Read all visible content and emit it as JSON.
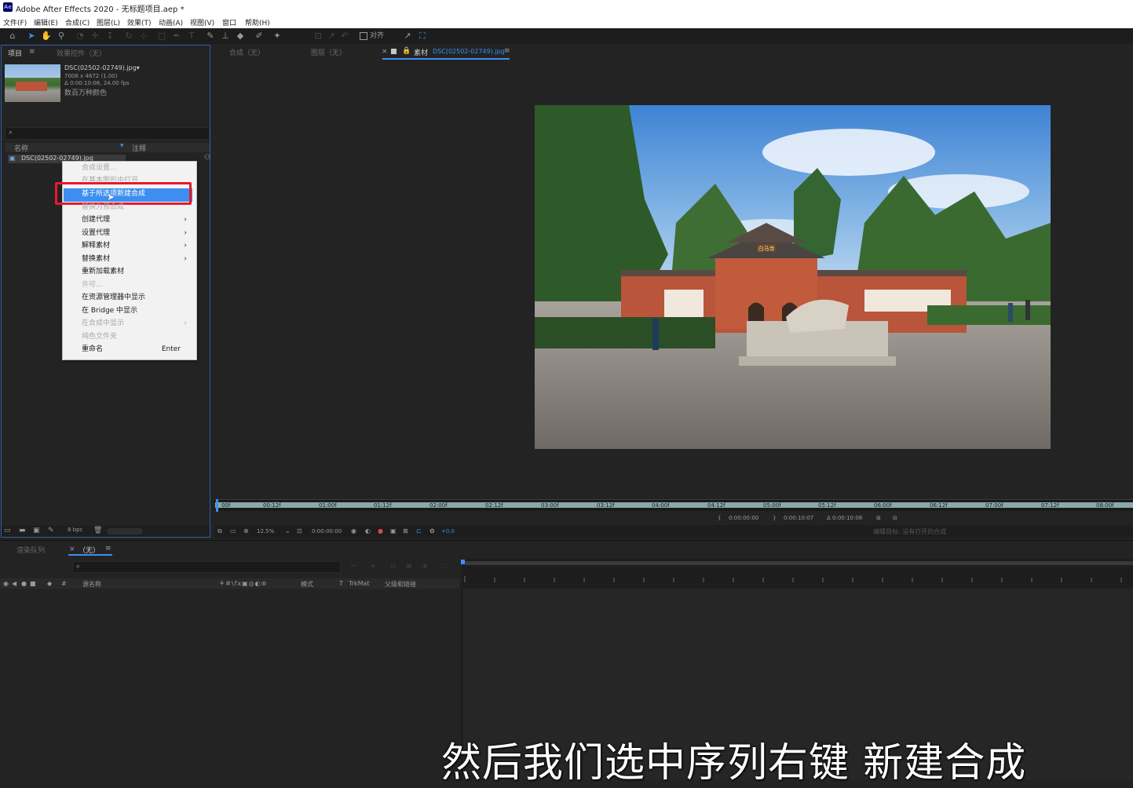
{
  "window": {
    "app_badge": "Ae",
    "title": "Adobe After Effects 2020 - 无标题项目.aep *"
  },
  "menu": [
    "文件(F)",
    "编辑(E)",
    "合成(C)",
    "图层(L)",
    "效果(T)",
    "动画(A)",
    "视图(V)",
    "窗口",
    "帮助(H)"
  ],
  "toolbar": {
    "align_label": "对齐"
  },
  "project_panel": {
    "tab_project": "项目",
    "tab_effects": "效果控件（无）",
    "file_name": "DSC(02502-02749).jpg▾",
    "file_dims": "7008 x 4672 (1.00)",
    "file_duration": "Δ 0:00:10:08, 24.00 fps",
    "file_colors": "数百万种颜色",
    "search_icon": "⌕",
    "col_name": "名称",
    "col_comment": "注释",
    "list_item": "DSC(02502-02749).jpg",
    "bpc": "8 bpc"
  },
  "context_menu": {
    "items": [
      {
        "label": "合成设置...",
        "disabled": true
      },
      {
        "label": "在基本图形中打开",
        "disabled": true
      },
      {
        "label": "基于所选项新建合成",
        "disabled": false,
        "highlighted": true
      },
      {
        "label": "替换为预合成",
        "disabled": true
      },
      {
        "label": "创建代理",
        "disabled": false,
        "submenu": true
      },
      {
        "label": "设置代理",
        "disabled": false,
        "submenu": true
      },
      {
        "label": "解释素材",
        "disabled": false,
        "submenu": true
      },
      {
        "label": "替换素材",
        "disabled": false,
        "submenu": true
      },
      {
        "label": "重新加载素材",
        "disabled": false
      },
      {
        "label": "许可...",
        "disabled": true
      },
      {
        "label": "在资源管理器中显示",
        "disabled": false
      },
      {
        "label": "在 Bridge 中显示",
        "disabled": false
      },
      {
        "label": "在合成中显示",
        "disabled": true,
        "submenu": true
      },
      {
        "label": "纯色文件夹",
        "disabled": true
      },
      {
        "label": "重命名",
        "disabled": false,
        "shortcut": "Enter"
      }
    ]
  },
  "viewer": {
    "tab_comp": "合成（无）",
    "tab_layer": "图层（无）",
    "tab_footage_prefix": "素材",
    "tab_footage_name": "DSC(02502-02749).jpg",
    "sign_text": "白马寺",
    "ruler_ticks": [
      "00f",
      "00:12f",
      "01:00f",
      "01:12f",
      "02:00f",
      "02:12f",
      "03:00f",
      "03:12f",
      "04:00f",
      "04:12f",
      "05:00f",
      "05:12f",
      "06:00f",
      "06:12f",
      "07:00f",
      "07:12f",
      "08:00f"
    ],
    "in_point": "0:00:00:00",
    "out_point": "0:00:10:07",
    "duration": "Δ 0:00:10:08",
    "zoom": "12.5%",
    "current_time": "0:00:00:00",
    "exposure": "+0.0",
    "edit_target": "编辑目标: 没有打开的合成"
  },
  "timeline": {
    "tab_render": "渲染队列",
    "tab_none": "（无）",
    "col_source": "源名称",
    "col_mode": "模式",
    "col_t": "T",
    "col_trkmat": "TrkMat",
    "col_parent": "父级和链接"
  },
  "subtitle": "然后我们选中序列右键  新建合成"
}
